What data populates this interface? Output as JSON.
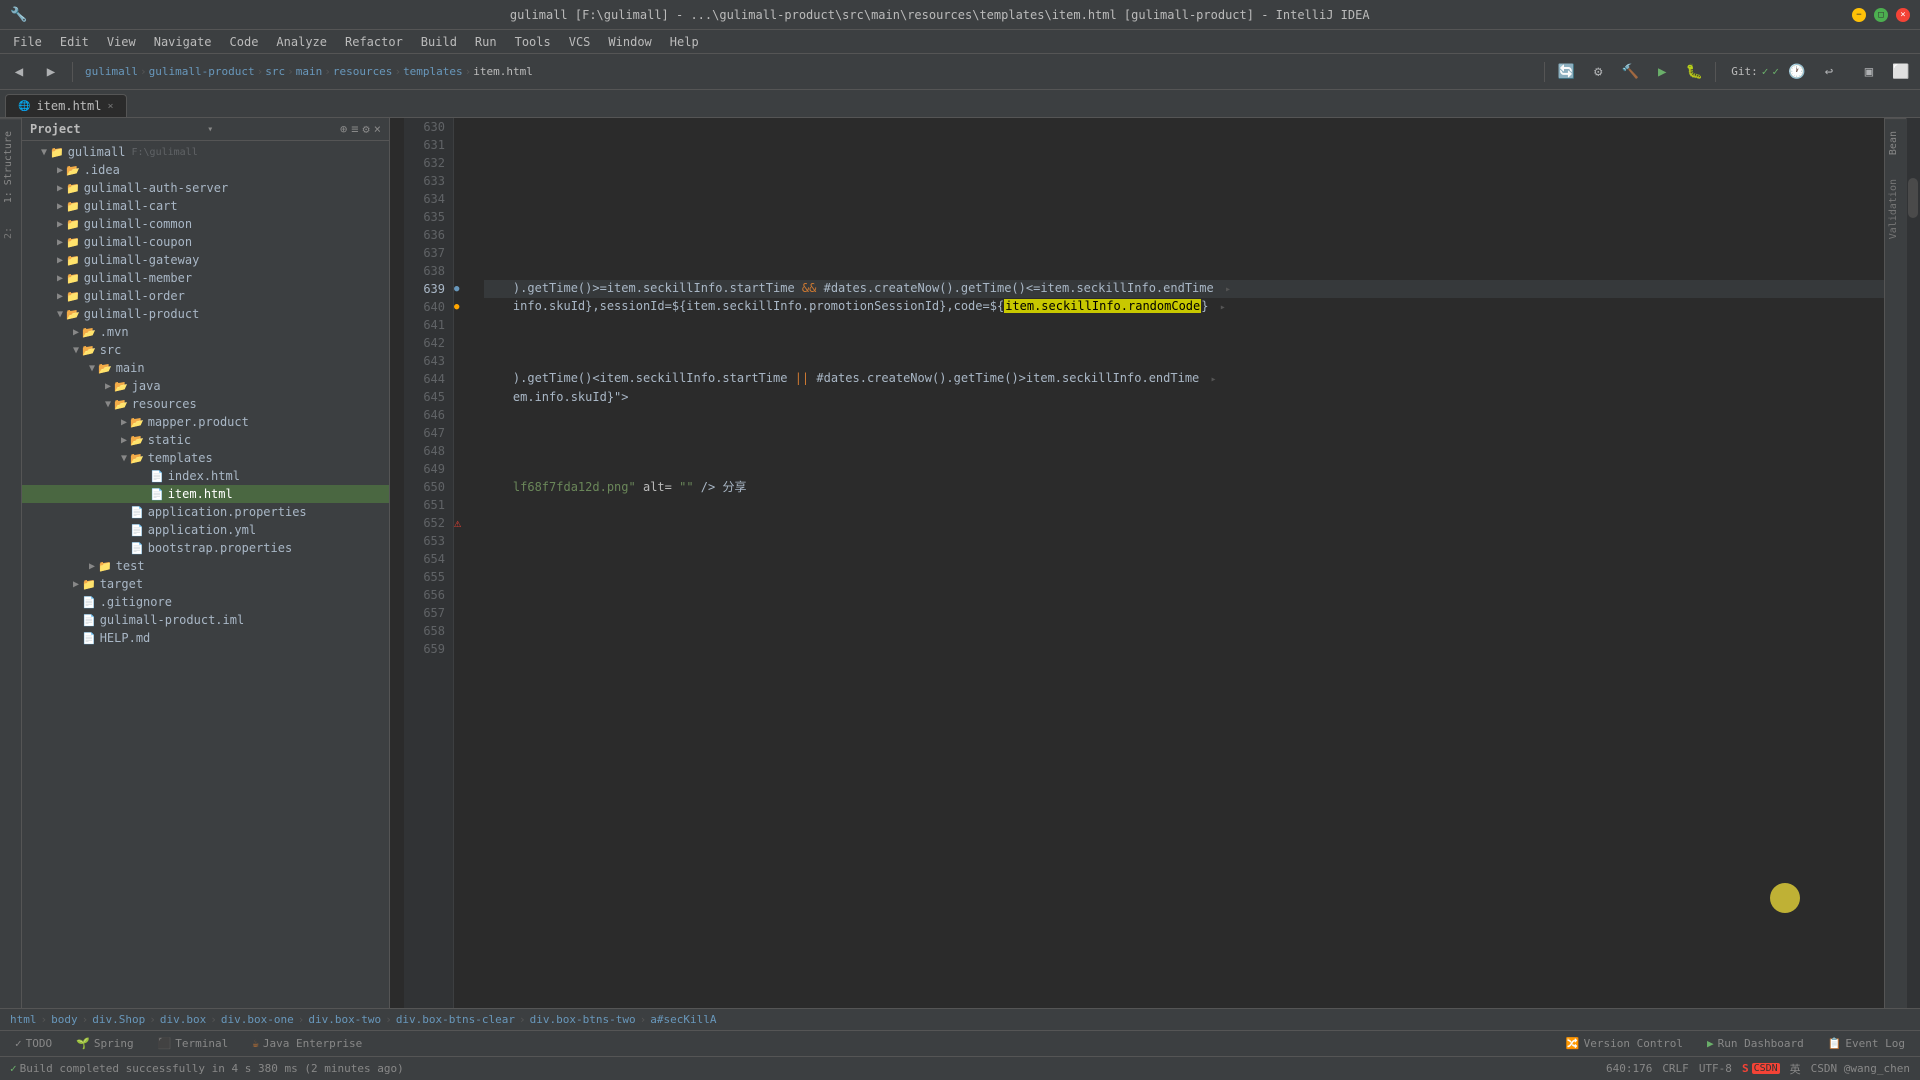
{
  "window": {
    "title": "gulimall [F:\\gulimall] - ...\\gulimall-product\\src\\main\\resources\\templates\\item.html [gulimall-product] - IntelliJ IDEA",
    "minimize": "−",
    "maximize": "□",
    "close": "×"
  },
  "menubar": {
    "items": [
      "File",
      "Edit",
      "View",
      "Navigate",
      "Code",
      "Analyze",
      "Refactor",
      "Build",
      "Run",
      "Tools",
      "VCS",
      "Window",
      "Help"
    ]
  },
  "toolbar": {
    "project_dropdown": "gulimall",
    "git_label": "Git:"
  },
  "breadcrumb": {
    "items": [
      "gulimall",
      "gulimall-product",
      "src",
      "main",
      "resources",
      "templates",
      "item.html"
    ]
  },
  "tab": {
    "label": "item.html",
    "icon": "🌐"
  },
  "project_tree": {
    "root": "gulimall",
    "root_path": "F:\\gulimall",
    "items": [
      {
        "id": "idea",
        "label": ".idea",
        "type": "folder",
        "indent": 1,
        "expanded": false
      },
      {
        "id": "auth-server",
        "label": "gulimall-auth-server",
        "type": "folder",
        "indent": 1,
        "expanded": false
      },
      {
        "id": "cart",
        "label": "gulimall-cart",
        "type": "folder",
        "indent": 1,
        "expanded": false
      },
      {
        "id": "common",
        "label": "gulimall-common",
        "type": "folder",
        "indent": 1,
        "expanded": false
      },
      {
        "id": "coupon",
        "label": "gulimall-coupon",
        "type": "folder",
        "indent": 1,
        "expanded": false
      },
      {
        "id": "gateway",
        "label": "gulimall-gateway",
        "type": "folder",
        "indent": 1,
        "expanded": false
      },
      {
        "id": "member",
        "label": "gulimall-member",
        "type": "folder",
        "indent": 1,
        "expanded": false
      },
      {
        "id": "order",
        "label": "gulimall-order",
        "type": "folder",
        "indent": 1,
        "expanded": false
      },
      {
        "id": "product",
        "label": "gulimall-product",
        "type": "folder",
        "indent": 1,
        "expanded": true
      },
      {
        "id": "mvn",
        "label": ".mvn",
        "type": "folder",
        "indent": 2,
        "expanded": false
      },
      {
        "id": "src",
        "label": "src",
        "type": "folder",
        "indent": 2,
        "expanded": true
      },
      {
        "id": "main",
        "label": "main",
        "type": "folder",
        "indent": 3,
        "expanded": true
      },
      {
        "id": "java",
        "label": "java",
        "type": "folder",
        "indent": 4,
        "expanded": false
      },
      {
        "id": "resources",
        "label": "resources",
        "type": "folder",
        "indent": 4,
        "expanded": true
      },
      {
        "id": "mapper.product",
        "label": "mapper.product",
        "type": "folder",
        "indent": 5,
        "expanded": false
      },
      {
        "id": "static",
        "label": "static",
        "type": "folder",
        "indent": 5,
        "expanded": false
      },
      {
        "id": "templates",
        "label": "templates",
        "type": "folder",
        "indent": 5,
        "expanded": true
      },
      {
        "id": "index.html",
        "label": "index.html",
        "type": "html",
        "indent": 6
      },
      {
        "id": "item.html",
        "label": "item.html",
        "type": "html",
        "indent": 6,
        "selected": true
      },
      {
        "id": "app-props",
        "label": "application.properties",
        "type": "props",
        "indent": 5
      },
      {
        "id": "app-yml",
        "label": "application.yml",
        "type": "yml",
        "indent": 5
      },
      {
        "id": "bootstrap-props",
        "label": "bootstrap.properties",
        "type": "props",
        "indent": 5
      },
      {
        "id": "test",
        "label": "test",
        "type": "folder",
        "indent": 3,
        "expanded": false
      },
      {
        "id": "target",
        "label": "target",
        "type": "folder",
        "indent": 2,
        "expanded": false
      },
      {
        "id": "gitignore",
        "label": ".gitignore",
        "type": "file",
        "indent": 2
      },
      {
        "id": "product-iml",
        "label": "gulimall-product.iml",
        "type": "iml",
        "indent": 2
      },
      {
        "id": "help-md",
        "label": "HELP.md",
        "type": "md",
        "indent": 2
      }
    ]
  },
  "code": {
    "lines": [
      {
        "num": 630,
        "content": "",
        "type": "empty"
      },
      {
        "num": 631,
        "content": "",
        "type": "empty"
      },
      {
        "num": 632,
        "content": "",
        "type": "empty"
      },
      {
        "num": 633,
        "content": "",
        "type": "empty"
      },
      {
        "num": 634,
        "content": "",
        "type": "empty"
      },
      {
        "num": 635,
        "content": "",
        "type": "empty"
      },
      {
        "num": 636,
        "content": "",
        "type": "empty"
      },
      {
        "num": 637,
        "content": "",
        "type": "empty"
      },
      {
        "num": 638,
        "content": "",
        "type": "empty"
      },
      {
        "num": 639,
        "content": "    ).getTime()>=item.seckillInfo.startTime && #dates.createNow().getTime()<=item.seckillInfo.endTime",
        "type": "code",
        "highlight": true
      },
      {
        "num": 640,
        "content": "    info.skuId},sessionId=${item.seckillInfo.promotionSessionId},code=${item.seckillInfo.randomCode}",
        "type": "code",
        "has_warning": true,
        "highlight_yellow": "item.seckillInfo.randomCode"
      },
      {
        "num": 641,
        "content": "",
        "type": "empty"
      },
      {
        "num": 642,
        "content": "",
        "type": "empty"
      },
      {
        "num": 643,
        "content": "",
        "type": "empty"
      },
      {
        "num": 644,
        "content": "    ).getTime()<item.seckillInfo.startTime || #dates.createNow().getTime()>item.seckillInfo.endTime",
        "type": "code"
      },
      {
        "num": 645,
        "content": "    em.info.skuId}\">",
        "type": "code"
      },
      {
        "num": 646,
        "content": "",
        "type": "empty"
      },
      {
        "num": 647,
        "content": "",
        "type": "empty"
      },
      {
        "num": 648,
        "content": "",
        "type": "empty"
      },
      {
        "num": 649,
        "content": "",
        "type": "empty"
      },
      {
        "num": 650,
        "content": "    lf68f7fda12d.png\" alt=\"\" /> 分享",
        "type": "code",
        "has_string": true
      },
      {
        "num": 651,
        "content": "",
        "type": "empty"
      },
      {
        "num": 652,
        "content": "",
        "type": "empty",
        "has_error": true
      },
      {
        "num": 653,
        "content": "",
        "type": "empty"
      },
      {
        "num": 654,
        "content": "",
        "type": "empty"
      },
      {
        "num": 655,
        "content": "",
        "type": "empty"
      },
      {
        "num": 656,
        "content": "",
        "type": "empty"
      },
      {
        "num": 657,
        "content": "",
        "type": "empty"
      },
      {
        "num": 658,
        "content": "",
        "type": "empty"
      },
      {
        "num": 659,
        "content": "",
        "type": "empty"
      }
    ]
  },
  "bottom_breadcrumb": {
    "items": [
      "html",
      "body",
      "div.Shop",
      "div.box",
      "div.box-one",
      "div.box-two",
      "div.box-btns-clear",
      "div.box-btns-two",
      "a#secKillA"
    ]
  },
  "status_bar": {
    "todo": "TODO",
    "spring": "Spring",
    "terminal": "Terminal",
    "java_enterprise": "Java Enterprise",
    "version_control": "Version Control",
    "run_dashboard": "Run Dashboard",
    "event_log": "Event Log",
    "position": "640:176",
    "line_ending": "CRLF",
    "encoding": "UTF-8",
    "build_status": "Build completed successfully in 4 s 380 ms (2 minutes ago)"
  },
  "side_labels": {
    "left": [
      "1:Structure",
      "2:"
    ],
    "right": [
      "Bean",
      "Validation"
    ]
  },
  "colors": {
    "bg_main": "#2b2b2b",
    "bg_panel": "#3c3f41",
    "accent_blue": "#6897bb",
    "accent_green": "#4a6741",
    "accent_orange": "#cc7832",
    "text_primary": "#a9b7c6",
    "highlight_yellow": "#c8c800",
    "error_red": "#f44336"
  }
}
